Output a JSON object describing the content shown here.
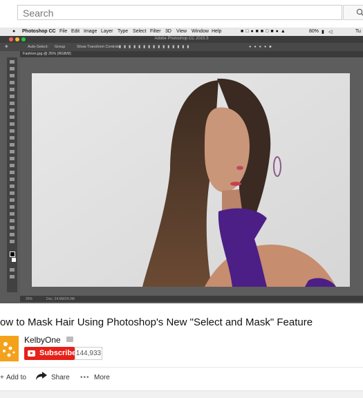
{
  "search": {
    "placeholder": "Search"
  },
  "screen": {
    "mac_menu": [
      "Photoshop CC",
      "File",
      "Edit",
      "Image",
      "Layer",
      "Type",
      "Select",
      "Filter",
      "3D",
      "View",
      "Window",
      "Help"
    ],
    "mac_status": "80%",
    "mac_clock": "Tu",
    "ps_title": "Adobe Photoshop CC 2015.5",
    "options_auto_select": "Auto-Select:",
    "options_group": "Group",
    "options_transform": "Show Transform Controls",
    "tab_label": "Fashion.jpg @ 25% (RGB/8)",
    "status_zoom": "25%",
    "status_doc": "Doc: 24.0M/24.0M"
  },
  "video": {
    "title": "ow to Mask Hair Using Photoshop's New \"Select and Mask\" Feature",
    "channel": "KelbyOne",
    "subscribe_label": "Subscribe",
    "subscriber_count": "144,933"
  },
  "actions": {
    "add_to": "Add to",
    "share": "Share",
    "more": "More"
  },
  "colors": {
    "subscribe_red": "#e62117",
    "avatar_orange": "#f4a21b",
    "scarf_purple": "#4b1f86"
  }
}
